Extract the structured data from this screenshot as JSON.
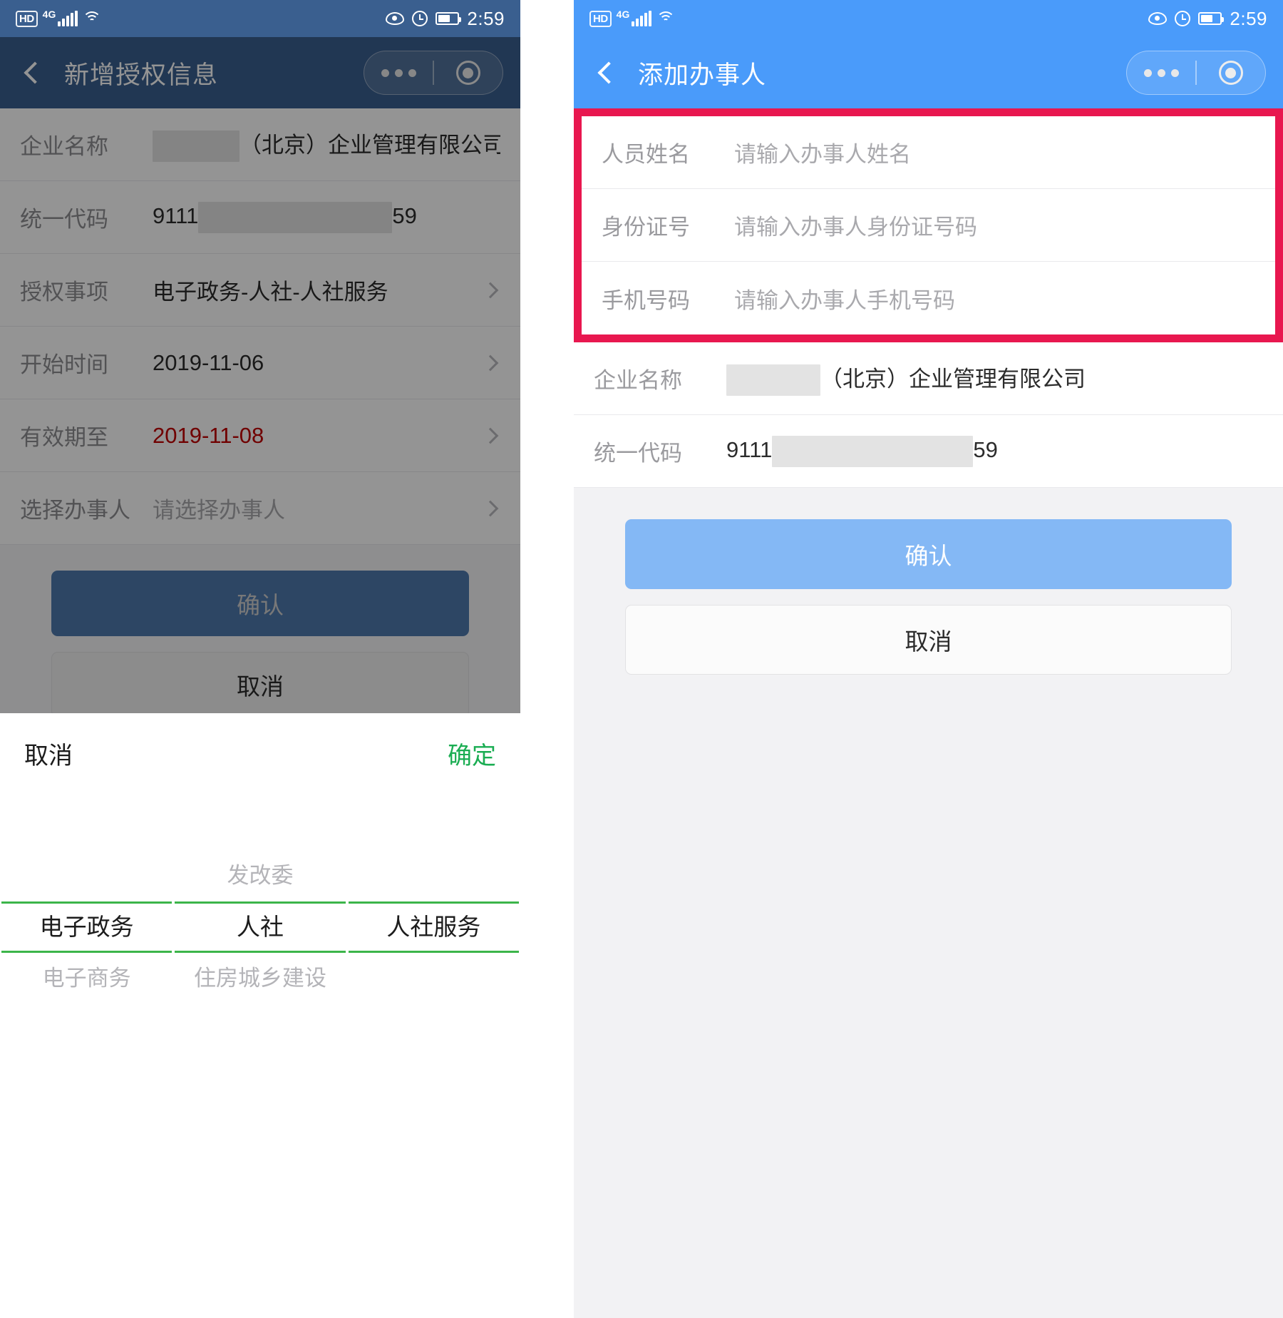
{
  "status_bar": {
    "hd": "HD",
    "network": "4G",
    "time": "2:59",
    "icons": [
      "hd-badge",
      "signal-bars-icon",
      "wifi-icon",
      "eye-icon",
      "alarm-clock-icon",
      "battery-icon"
    ]
  },
  "colors": {
    "left_header": "#3a5f8f",
    "right_header": "#4a9bfa",
    "highlight_border": "#e8174f",
    "primary_button": "#84b8f5",
    "picker_accent": "#3cb54a",
    "confirm_green": "#1aad52",
    "expiry_red": "#c20000"
  },
  "left_screen": {
    "nav": {
      "title": "新增授权信息",
      "back": "返回",
      "more": "更多",
      "target": "胶囊按钮"
    },
    "rows": [
      {
        "label": "企业名称",
        "value_prefix": "",
        "redacted": true,
        "value": "（北京）企业管理有限公司",
        "chevron": false
      },
      {
        "label": "统一代码",
        "value_prefix": "9111",
        "redacted": true,
        "value": "59",
        "chevron": false
      },
      {
        "label": "授权事项",
        "value": "电子政务-人社-人社服务",
        "chevron": true
      },
      {
        "label": "开始时间",
        "value": "2019-11-06",
        "chevron": true
      },
      {
        "label": "有效期至",
        "value": "2019-11-08",
        "chevron": true,
        "red": true
      },
      {
        "label": "选择办事人",
        "value": "请选择办事人",
        "placeholder": true,
        "chevron": true
      }
    ],
    "buttons": {
      "confirm": "确认",
      "cancel": "取消"
    },
    "picker": {
      "cancel": "取消",
      "confirm": "确定",
      "columns": [
        {
          "above": "",
          "selected": "电子政务",
          "below": "电子商务"
        },
        {
          "above": "发改委",
          "selected": "人社",
          "below": "住房城乡建设"
        },
        {
          "above": "",
          "selected": "人社服务",
          "below": ""
        }
      ]
    }
  },
  "right_screen": {
    "nav": {
      "title": "添加办事人",
      "back": "返回",
      "more": "更多",
      "target": "胶囊按钮"
    },
    "highlighted_rows": [
      {
        "label": "人员姓名",
        "value": "请输入办事人姓名",
        "placeholder": true
      },
      {
        "label": "身份证号",
        "value": "请输入办事人身份证号码",
        "placeholder": true
      },
      {
        "label": "手机号码",
        "value": "请输入办事人手机号码",
        "placeholder": true
      }
    ],
    "info_rows": [
      {
        "label": "企业名称",
        "value_prefix": "",
        "redacted": true,
        "value": "（北京）企业管理有限公司"
      },
      {
        "label": "统一代码",
        "value_prefix": "9111",
        "redacted": true,
        "value": "59"
      }
    ],
    "buttons": {
      "confirm": "确认",
      "cancel": "取消"
    }
  }
}
